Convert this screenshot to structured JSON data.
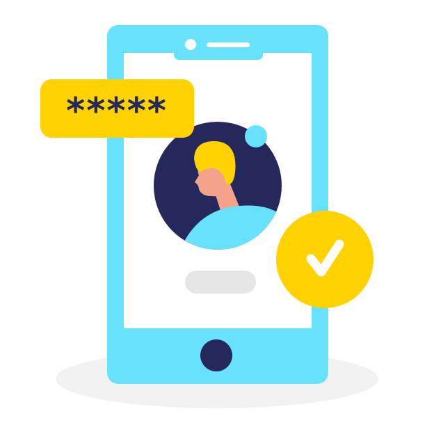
{
  "illustration": {
    "password_mask": "*****",
    "icons": {
      "phone": "smartphone-icon",
      "avatar": "user-avatar-icon",
      "online_dot": "status-dot-icon",
      "check": "checkmark-icon",
      "home_button": "home-button-icon"
    },
    "colors": {
      "phone_body": "#68E1FD",
      "screen": "#FFFFFF",
      "accent_yellow": "#FFD200",
      "navy": "#24285B",
      "skin": "#F4A28C",
      "placeholder_bar": "#E6E6E6",
      "shadow": "#F2F2F2"
    }
  }
}
